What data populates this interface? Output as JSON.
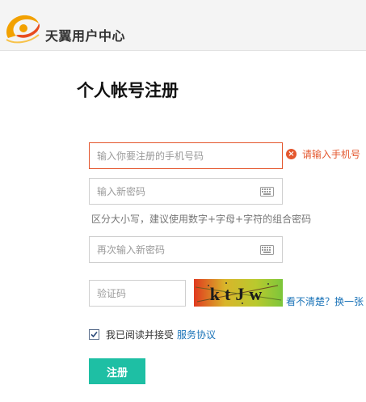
{
  "header": {
    "brand_name": "天翼用户中心",
    "logo_icon": "tianyi-logo-icon",
    "logo_colors": [
      "#f2a100",
      "#e84c1e"
    ]
  },
  "page_title": "个人帐号注册",
  "form": {
    "phone": {
      "placeholder": "输入你要注册的手机号码",
      "value": "",
      "error_text": "请输入手机号",
      "error_icon": "error-x-icon"
    },
    "password": {
      "placeholder": "输入新密码",
      "value": "",
      "keyboard_icon": "keyboard-icon",
      "hint": "区分大小写，建议使用数字+字母+字符的组合密码"
    },
    "confirm_password": {
      "placeholder": "再次输入新密码",
      "value": "",
      "keyboard_icon": "keyboard-icon"
    },
    "captcha": {
      "placeholder": "验证码",
      "value": "",
      "image_text": "ktJw",
      "refresh_link": "看不清楚？换一张"
    },
    "agreement": {
      "checked": true,
      "text": "我已阅读并接受",
      "link_text": "服务协议"
    },
    "submit_label": "注册"
  },
  "colors": {
    "accent": "#1ebfa4",
    "error": "#e4572e",
    "link": "#1a73b8"
  }
}
